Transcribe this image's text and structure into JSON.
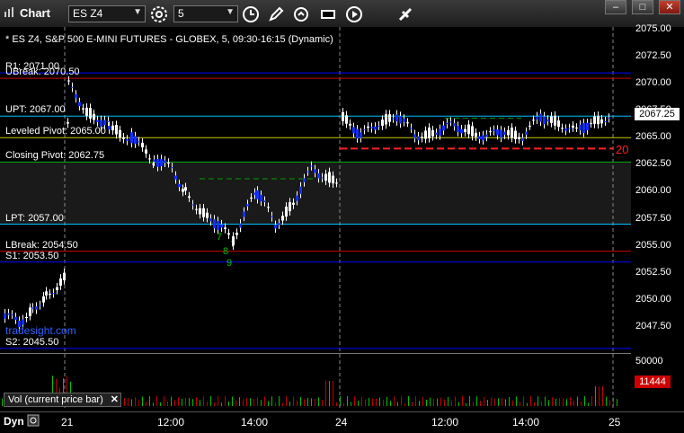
{
  "window": {
    "title": "Chart"
  },
  "toolbar": {
    "symbol": "ES Z4",
    "interval": "5",
    "icons": [
      "settings-icon",
      "clock-icon",
      "pencil-icon",
      "refresh-icon",
      "snapshot-icon",
      "play-icon",
      "link-icon"
    ]
  },
  "chart": {
    "header": "* ES Z4, S&P 500 E-MINI FUTURES - GLOBEX, 5, 09:30-16:15 (Dynamic)",
    "pivots": [
      {
        "label": "R1: 2071.00",
        "price": 2071.0,
        "color": "#0000ff"
      },
      {
        "label": "UBreak: 2070.50",
        "price": 2070.5,
        "color": "#cc0000"
      },
      {
        "label": "UPT: 2067.00",
        "price": 2067.0,
        "color": "#00c0ff"
      },
      {
        "label": "Leveled Pivot: 2065.00",
        "price": 2065.0,
        "color": "#c8c800"
      },
      {
        "label": "Closing Pivot: 2062.75",
        "price": 2062.75,
        "color": "#00b000"
      },
      {
        "label": "LPT: 2057.00",
        "price": 2057.0,
        "color": "#00c0ff"
      },
      {
        "label": "LBreak: 2054.50",
        "price": 2054.5,
        "color": "#cc0000"
      },
      {
        "label": "S1: 2053.50",
        "price": 2053.5,
        "color": "#0000ff"
      },
      {
        "label": "S2: 2045.50",
        "price": 2045.5,
        "color": "#0000ff"
      }
    ],
    "watermark": "tradesight.com",
    "annotation_20": "20",
    "annotation_9": "9",
    "annotation_8": "8",
    "annotation_7": "7",
    "current_price": "2067.25"
  },
  "price_axis": {
    "ticks": [
      "2075.00",
      "2072.50",
      "2070.00",
      "2067.50",
      "2065.00",
      "2062.50",
      "2060.00",
      "2057.50",
      "2055.00",
      "2052.50",
      "2050.00",
      "2047.50"
    ],
    "min": 2045.5,
    "max": 2075.0
  },
  "volume": {
    "label": "Vol (current price bar)",
    "tick": "50000",
    "current": "11444"
  },
  "time_axis": {
    "ticks": [
      "21",
      "12:00",
      "14:00",
      "24",
      "12:00",
      "14:00",
      "25"
    ]
  },
  "footer": {
    "dyn": "Dyn"
  }
}
